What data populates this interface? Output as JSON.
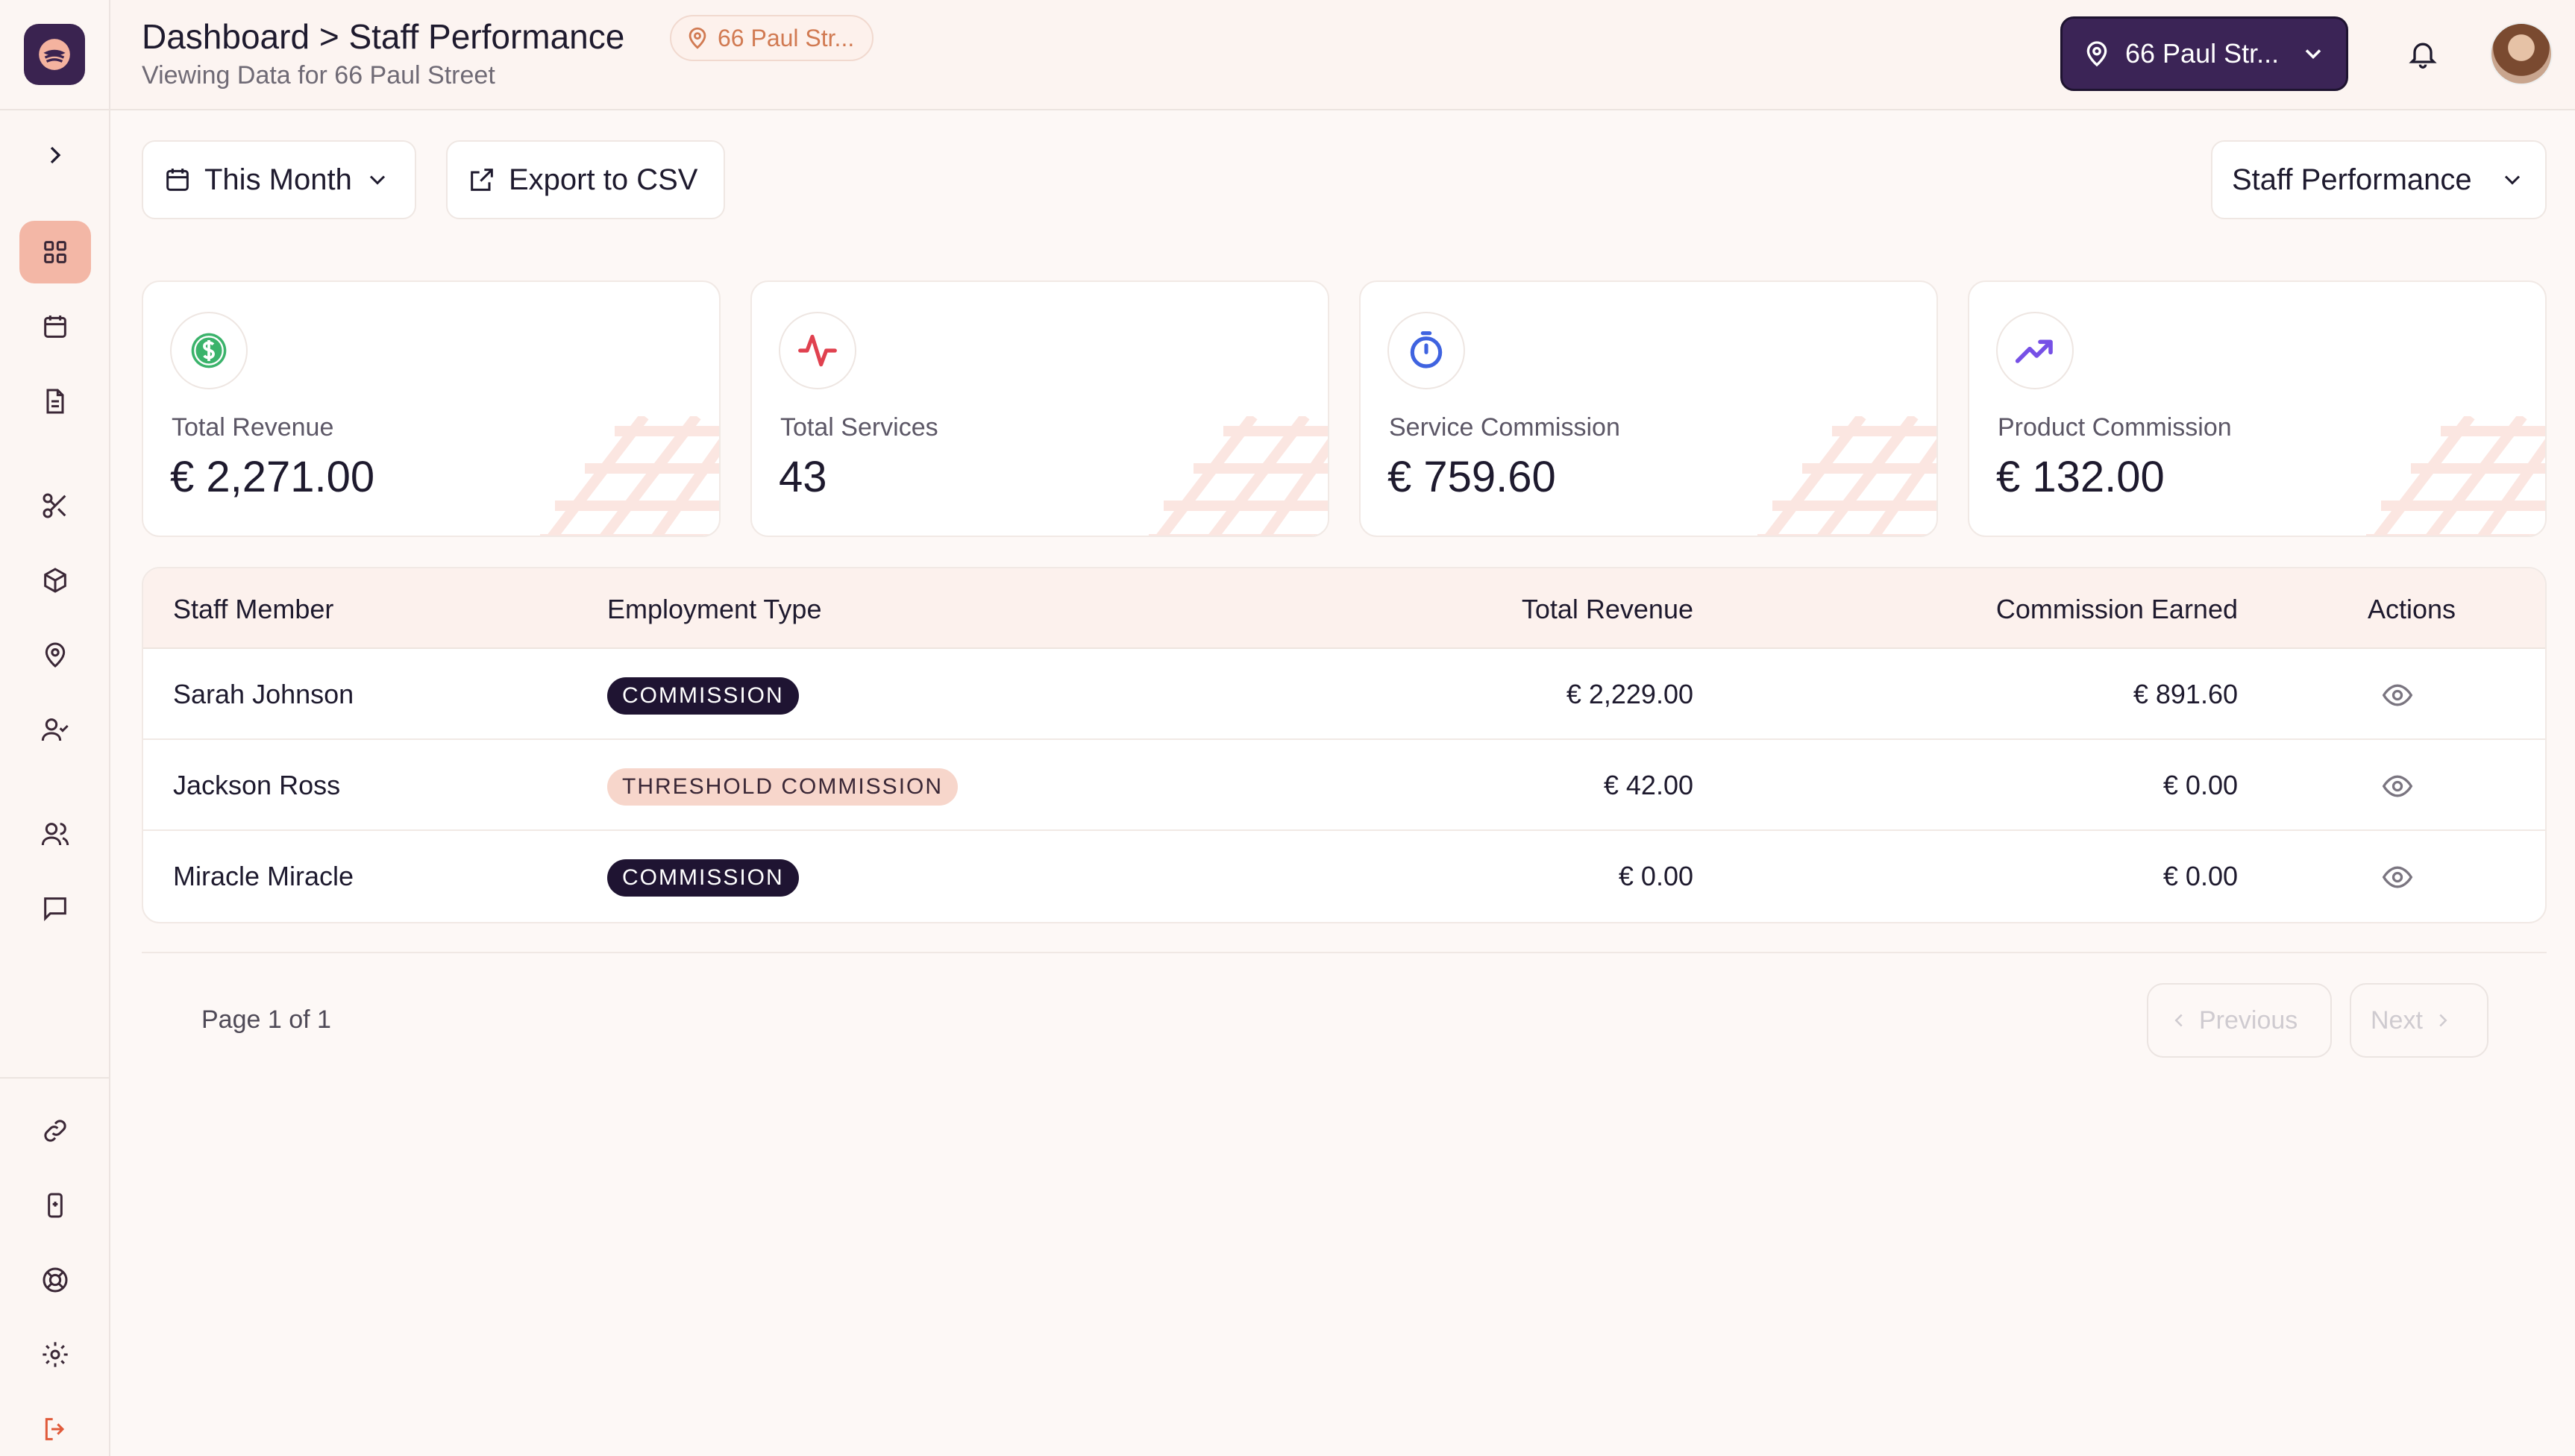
{
  "header": {
    "breadcrumb": "Dashboard > Staff Performance",
    "location_chip": "66 Paul Str...",
    "subtitle": "Viewing Data for 66 Paul Street",
    "location_button": "66 Paul Str..."
  },
  "toolbar": {
    "date_filter": "This Month",
    "export_label": "Export to CSV",
    "report_select": "Staff Performance"
  },
  "stats": [
    {
      "label": "Total Revenue",
      "value": "€ 2,271.00",
      "icon": "dollar-circle-icon",
      "color": "#3bb36b"
    },
    {
      "label": "Total Services",
      "value": "43",
      "icon": "activity-icon",
      "color": "#e0414f"
    },
    {
      "label": "Service Commission",
      "value": "€ 759.60",
      "icon": "timer-icon",
      "color": "#3f63e0"
    },
    {
      "label": "Product Commission",
      "value": "€ 132.00",
      "icon": "trending-up-icon",
      "color": "#7650e6"
    }
  ],
  "table": {
    "columns": [
      "Staff Member",
      "Employment Type",
      "Total Revenue",
      "Commission Earned",
      "Actions"
    ],
    "rows": [
      {
        "name": "Sarah Johnson",
        "type": "COMMISSION",
        "revenue": "€ 2,229.00",
        "commission": "€ 891.60"
      },
      {
        "name": "Jackson Ross",
        "type": "THRESHOLD COMMISSION",
        "revenue": "€ 42.00",
        "commission": "€ 0.00"
      },
      {
        "name": "Miracle Miracle",
        "type": "COMMISSION",
        "revenue": "€ 0.00",
        "commission": "€ 0.00"
      }
    ]
  },
  "pagination": {
    "info": "Page 1 of 1",
    "previous": "Previous",
    "next": "Next"
  },
  "colors": {
    "accent": "#3b2456",
    "active_nav": "#f3b7a6",
    "logout": "#e05a3a"
  }
}
